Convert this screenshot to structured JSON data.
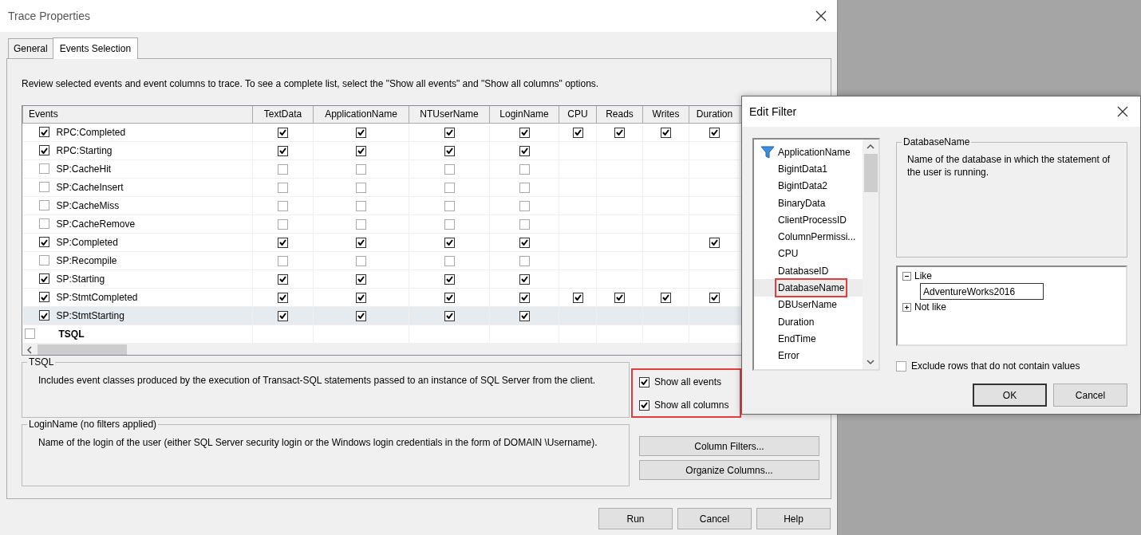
{
  "window": {
    "title": "Trace Properties"
  },
  "tabs": [
    {
      "label": "General",
      "selected": false
    },
    {
      "label": "Events Selection",
      "selected": true
    }
  ],
  "instructions": "Review selected events and event columns to trace. To see a complete list, select the \"Show all events\" and \"Show all columns\" options.",
  "grid": {
    "columns": [
      "Events",
      "TextData",
      "ApplicationName",
      "NTUserName",
      "LoginName",
      "CPU",
      "Reads",
      "Writes",
      "Duration"
    ],
    "rows": [
      {
        "kind": "event",
        "name": "RPC:Completed",
        "checked": true,
        "selected": false,
        "cells": [
          true,
          true,
          true,
          true,
          true,
          true,
          true,
          true
        ]
      },
      {
        "kind": "event",
        "name": "RPC:Starting",
        "checked": true,
        "selected": false,
        "cells": [
          true,
          true,
          true,
          true,
          null,
          null,
          null,
          null
        ]
      },
      {
        "kind": "event",
        "name": "SP:CacheHit",
        "checked": false,
        "selected": false,
        "cells": [
          false,
          false,
          false,
          false,
          null,
          null,
          null,
          null
        ]
      },
      {
        "kind": "event",
        "name": "SP:CacheInsert",
        "checked": false,
        "selected": false,
        "cells": [
          false,
          false,
          false,
          false,
          null,
          null,
          null,
          null
        ]
      },
      {
        "kind": "event",
        "name": "SP:CacheMiss",
        "checked": false,
        "selected": false,
        "cells": [
          false,
          false,
          false,
          false,
          null,
          null,
          null,
          null
        ]
      },
      {
        "kind": "event",
        "name": "SP:CacheRemove",
        "checked": false,
        "selected": false,
        "cells": [
          false,
          false,
          false,
          false,
          null,
          null,
          null,
          null
        ]
      },
      {
        "kind": "event",
        "name": "SP:Completed",
        "checked": true,
        "selected": false,
        "cells": [
          true,
          true,
          true,
          true,
          null,
          null,
          null,
          true
        ]
      },
      {
        "kind": "event",
        "name": "SP:Recompile",
        "checked": false,
        "selected": false,
        "cells": [
          false,
          false,
          false,
          false,
          null,
          null,
          null,
          null
        ]
      },
      {
        "kind": "event",
        "name": "SP:Starting",
        "checked": true,
        "selected": false,
        "cells": [
          true,
          true,
          true,
          true,
          null,
          null,
          null,
          null
        ]
      },
      {
        "kind": "event",
        "name": "SP:StmtCompleted",
        "checked": true,
        "selected": false,
        "cells": [
          true,
          true,
          true,
          true,
          true,
          true,
          true,
          true
        ]
      },
      {
        "kind": "event",
        "name": "SP:StmtStarting",
        "checked": true,
        "selected": true,
        "cells": [
          true,
          true,
          true,
          true,
          null,
          null,
          null,
          null
        ]
      },
      {
        "kind": "category",
        "name": "TSQL",
        "checked": false,
        "selected": false
      }
    ]
  },
  "event_group": {
    "title": "TSQL",
    "description": "Includes event classes produced by the execution of Transact-SQL statements passed to an instance of SQL Server from the client."
  },
  "options": {
    "highlighted": true,
    "items": [
      {
        "label": "Show all events",
        "checked": true
      },
      {
        "label": "Show all columns",
        "checked": true
      }
    ]
  },
  "column_group": {
    "title": "LoginName (no filters applied)",
    "description": "Name of the login of the user (either SQL Server security login or the Windows login credentials in the form of DOMAIN \\Username)."
  },
  "side_buttons": [
    "Column Filters...",
    "Organize Columns..."
  ],
  "footer_buttons": [
    "Run",
    "Cancel",
    "Help"
  ],
  "edit_filter": {
    "title": "Edit Filter",
    "columns": [
      {
        "label": "ApplicationName",
        "filtered": true,
        "selected": false,
        "highlighted": false
      },
      {
        "label": "BigintData1",
        "filtered": false,
        "selected": false,
        "highlighted": false
      },
      {
        "label": "BigintData2",
        "filtered": false,
        "selected": false,
        "highlighted": false
      },
      {
        "label": "BinaryData",
        "filtered": false,
        "selected": false,
        "highlighted": false
      },
      {
        "label": "ClientProcessID",
        "filtered": false,
        "selected": false,
        "highlighted": false
      },
      {
        "label": "ColumnPermissi...",
        "filtered": false,
        "selected": false,
        "highlighted": false
      },
      {
        "label": "CPU",
        "filtered": false,
        "selected": false,
        "highlighted": false
      },
      {
        "label": "DatabaseID",
        "filtered": false,
        "selected": false,
        "highlighted": false
      },
      {
        "label": "DatabaseName",
        "filtered": false,
        "selected": true,
        "highlighted": true
      },
      {
        "label": "DBUserName",
        "filtered": false,
        "selected": false,
        "highlighted": false
      },
      {
        "label": "Duration",
        "filtered": false,
        "selected": false,
        "highlighted": false
      },
      {
        "label": "EndTime",
        "filtered": false,
        "selected": false,
        "highlighted": false
      },
      {
        "label": "Error",
        "filtered": false,
        "selected": false,
        "highlighted": false
      }
    ],
    "description": {
      "title": "DatabaseName",
      "text": "Name of the database in which the statement of the user is running."
    },
    "tree": [
      {
        "label": "Like",
        "expanded": true,
        "children": [
          {
            "kind": "input",
            "value": "AdventureWorks2016"
          }
        ]
      },
      {
        "label": "Not like",
        "expanded": false
      }
    ],
    "exclude": {
      "label": "Exclude rows that do not contain values",
      "checked": false
    },
    "buttons": [
      {
        "label": "OK",
        "default": true
      },
      {
        "label": "Cancel",
        "default": false
      }
    ]
  }
}
